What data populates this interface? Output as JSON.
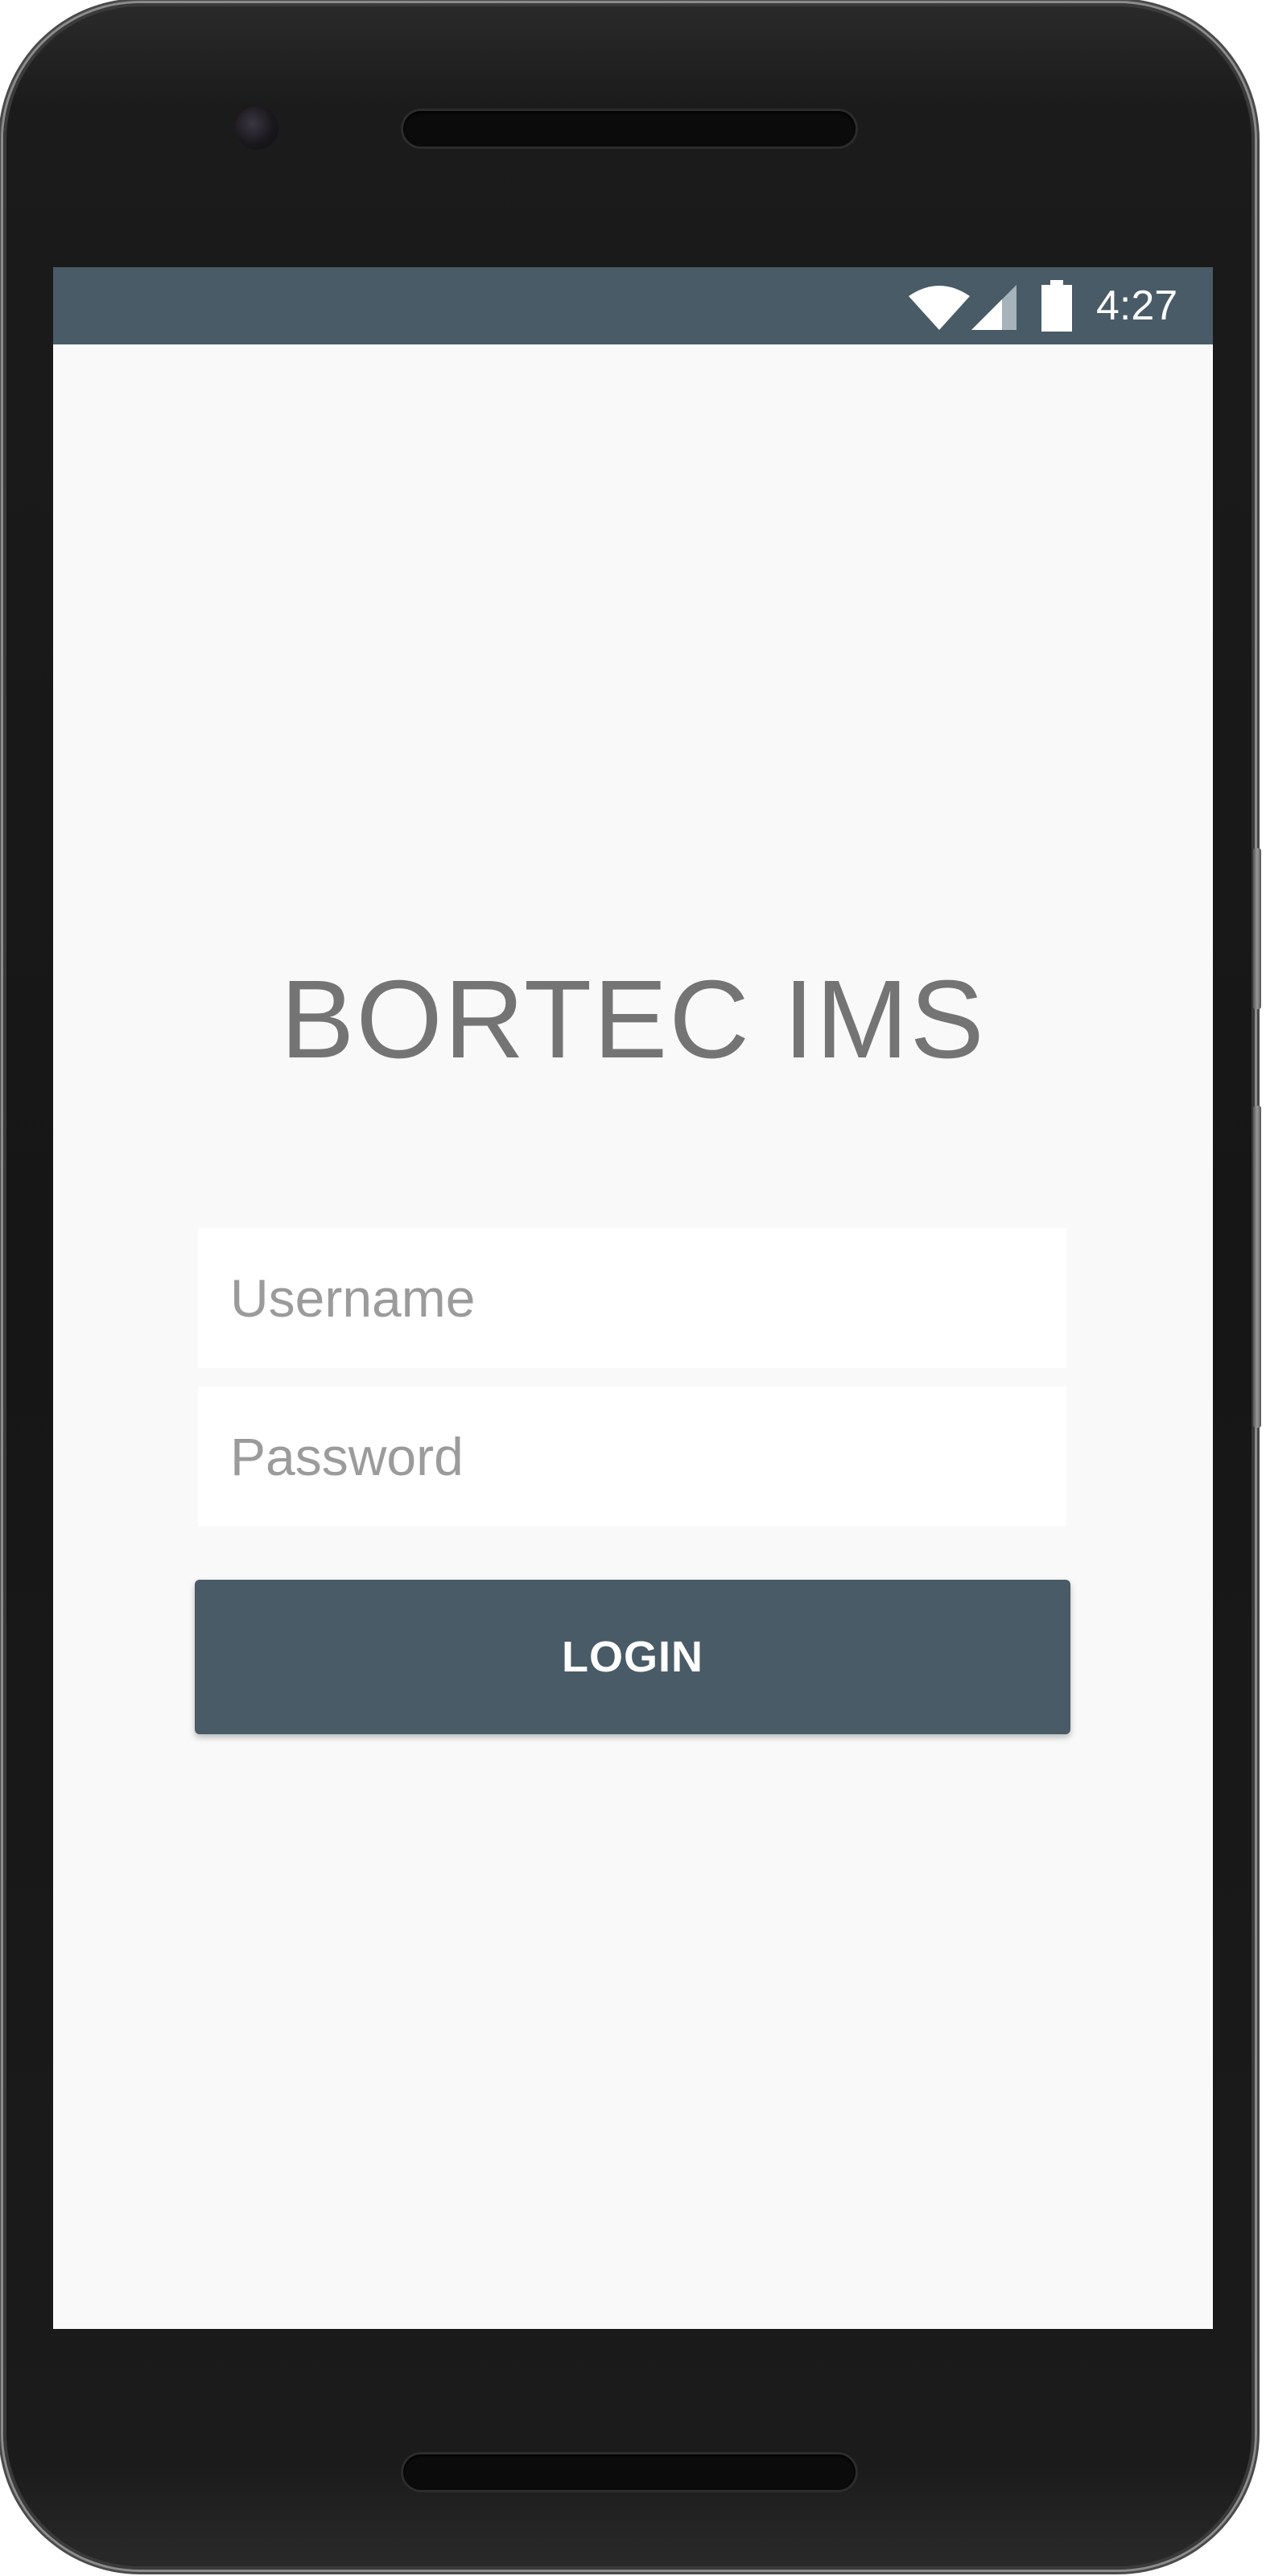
{
  "status_bar": {
    "time": "4:27",
    "background_color": "#485b66",
    "icons": [
      "wifi-icon",
      "cellular-signal-icon",
      "battery-icon"
    ]
  },
  "app": {
    "title": "BORTEC IMS"
  },
  "login_form": {
    "username_placeholder": "Username",
    "username_value": "",
    "password_placeholder": "Password",
    "password_value": "",
    "login_label": "LOGIN",
    "button_color": "#485b66"
  }
}
